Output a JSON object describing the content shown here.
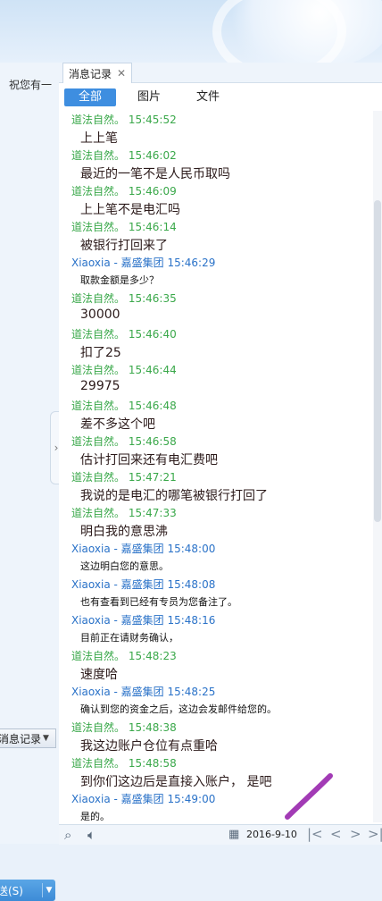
{
  "left": {
    "greeting": "祝您有一",
    "message_log_button": "消息记录",
    "send_button": "送(S)"
  },
  "history": {
    "tab_label": "消息记录",
    "filters": [
      "全部",
      "图片",
      "文件"
    ],
    "messages": [
      {
        "sender": "道法自然。",
        "time": "15:45:52",
        "text": "上上笔",
        "who": "self"
      },
      {
        "sender": "道法自然。",
        "time": "15:46:02",
        "text": "最近的一笔不是人民币取吗",
        "who": "self"
      },
      {
        "sender": "道法自然。",
        "time": "15:46:09",
        "text": "上上笔不是电汇吗",
        "who": "self"
      },
      {
        "sender": "道法自然。",
        "time": "15:46:14",
        "text": "被银行打回来了",
        "who": "self"
      },
      {
        "sender": "Xiaoxia - 嘉盛集团",
        "time": "15:46:29",
        "text": "取款金额是多少？",
        "who": "other"
      },
      {
        "sender": "道法自然。",
        "time": "15:46:35",
        "text": "30000",
        "who": "self"
      },
      {
        "sender": "道法自然。",
        "time": "15:46:40",
        "text": "扣了25",
        "who": "self"
      },
      {
        "sender": "道法自然。",
        "time": "15:46:44",
        "text": "29975",
        "who": "self"
      },
      {
        "sender": "道法自然。",
        "time": "15:46:48",
        "text": "差不多这个吧",
        "who": "self"
      },
      {
        "sender": "道法自然。",
        "time": "15:46:58",
        "text": "估计打回来还有电汇费吧",
        "who": "self"
      },
      {
        "sender": "道法自然。",
        "time": "15:47:21",
        "text": "我说的是电汇的哪笔被银行打回了",
        "who": "self"
      },
      {
        "sender": "道法自然。",
        "time": "15:47:33",
        "text": "明白我的意思沸",
        "who": "self"
      },
      {
        "sender": "Xiaoxia - 嘉盛集团",
        "time": "15:48:00",
        "text": "这边明白您的意思。",
        "who": "other"
      },
      {
        "sender": "Xiaoxia - 嘉盛集团",
        "time": "15:48:08",
        "text": "也有查看到已经有专员为您备注了。",
        "who": "other"
      },
      {
        "sender": "Xiaoxia - 嘉盛集团",
        "time": "15:48:16",
        "text": "目前正在请财务确认，",
        "who": "other"
      },
      {
        "sender": "道法自然。",
        "time": "15:48:23",
        "text": "速度哈",
        "who": "self"
      },
      {
        "sender": "Xiaoxia - 嘉盛集团",
        "time": "15:48:25",
        "text": "确认到您的资金之后，这边会发邮件给您的。",
        "who": "other"
      },
      {
        "sender": "道法自然。",
        "time": "15:48:38",
        "text": "我这边账户仓位有点重哈",
        "who": "self"
      },
      {
        "sender": "道法自然。",
        "time": "15:48:58",
        "text": "到你们这边后是直接入账户，    是吧",
        "who": "self"
      },
      {
        "sender": "Xiaoxia - 嘉盛集团",
        "time": "15:49:00",
        "text": "是的。",
        "who": "other"
      }
    ],
    "date": "2016-9-10"
  },
  "icons": [
    "search-icon",
    "volume-icon",
    "calendar-icon",
    "first-page-icon",
    "prev-page-icon",
    "next-page-icon",
    "last-page-icon"
  ],
  "colors": {
    "self_sender": "#3aa84a",
    "other_sender": "#2a72c8",
    "active_filter": "#3e8ee0",
    "annotation": "#a23bb5"
  }
}
